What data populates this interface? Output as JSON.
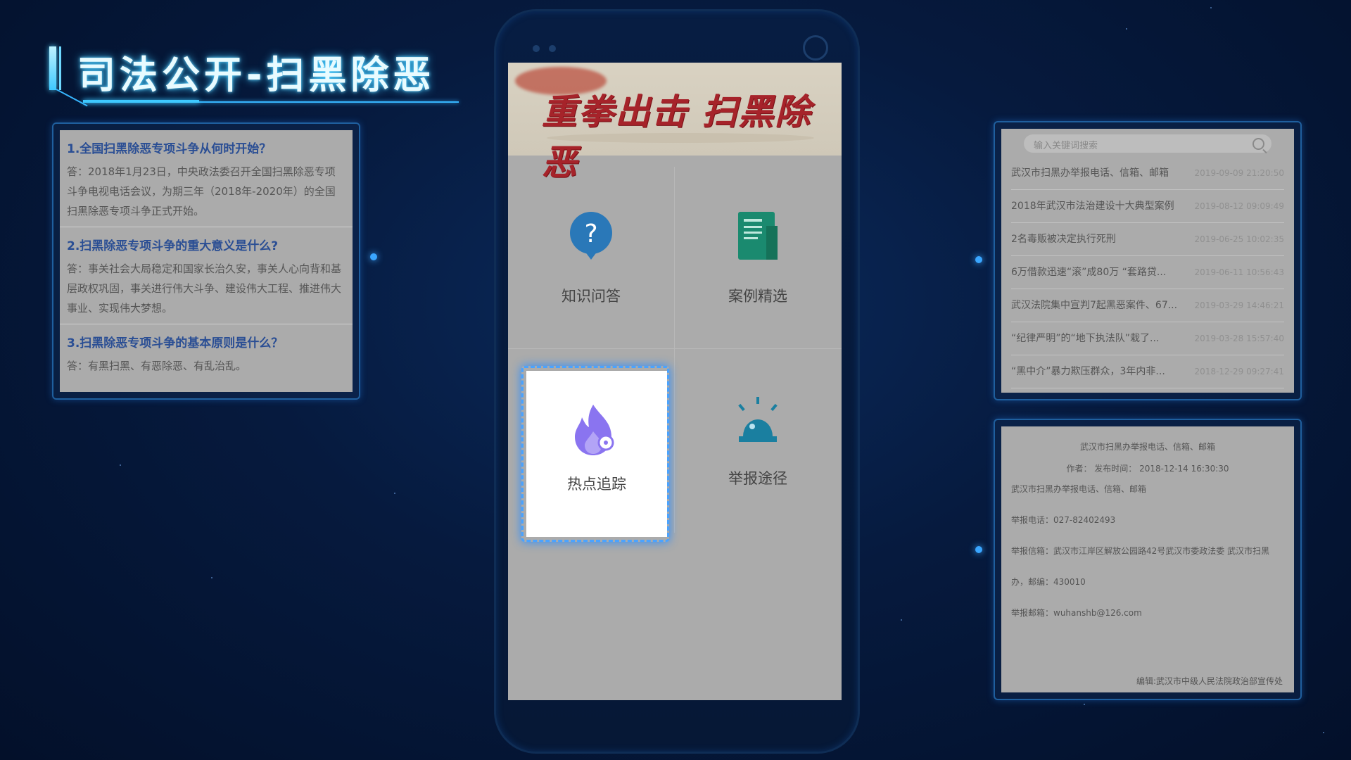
{
  "header": {
    "title": "司法公开-扫黑除恶"
  },
  "faq": {
    "items": [
      {
        "question": "1.全国扫黑除恶专项斗争从何时开始？",
        "answer": "答：2018年1月23日，中央政法委召开全国扫黑除恶专项斗争电视电话会议，为期三年（2018年-2020年）的全国扫黑除恶专项斗争正式开始。"
      },
      {
        "question": "2.扫黑除恶专项斗争的重大意义是什么?",
        "answer": "答：事关社会大局稳定和国家长治久安，事关人心向背和基层政权巩固，事关进行伟大斗争、建设伟大工程、推进伟大事业、实现伟大梦想。"
      },
      {
        "question": "3.扫黑除恶专项斗争的基本原则是什么？",
        "answer": "答：有黑扫黑、有恶除恶、有乱治乱。"
      }
    ]
  },
  "phone": {
    "banner_text": "重拳出击 扫黑除恶",
    "menu": [
      {
        "label": "知识问答",
        "icon": "question-bubble-icon",
        "color": "#2a78b8"
      },
      {
        "label": "案例精选",
        "icon": "document-icon",
        "color": "#1a8a6f"
      },
      {
        "label": "热点追踪",
        "icon": "flame-icon",
        "color": "#8a74f0",
        "selected": true
      },
      {
        "label": "举报途径",
        "icon": "alarm-light-icon",
        "color": "#1a7fa0"
      }
    ]
  },
  "news": {
    "search_placeholder": "输入关键词搜索",
    "rows": [
      {
        "title": "武汉市扫黑办举报电话、信箱、邮箱",
        "date": "2019-09-09 21:20:50"
      },
      {
        "title": "2018年武汉市法治建设十大典型案例",
        "date": "2019-08-12 09:09:49"
      },
      {
        "title": "2名毒贩被决定执行死刑",
        "date": "2019-06-25 10:02:35"
      },
      {
        "title": "6万借款迅速“滚”成80万 “套路贷...",
        "date": "2019-06-11 10:56:43"
      },
      {
        "title": "武汉法院集中宣判7起黑恶案件、67...",
        "date": "2019-03-29 14:46:21"
      },
      {
        "title": "“纪律严明”的“地下执法队”栽了...",
        "date": "2019-03-28 15:57:40"
      },
      {
        "title": "“黑中介”暴力欺压群众，3年内非...",
        "date": "2018-12-29 09:27:41"
      }
    ]
  },
  "article": {
    "title": "武汉市扫黑办举报电话、信箱、邮箱",
    "meta": "作者：  发布时间：  2018-12-14 16:30:30",
    "lines": [
      "武汉市扫黑办举报电话、信箱、邮箱",
      "举报电话：027-82402493",
      "举报信箱：武汉市江岸区解放公园路42号武汉市委政法委 武汉市扫黑",
      "办，邮编：430010",
      "举报邮箱：wuhanshb@126.com"
    ],
    "footer": "编辑:武汉市中级人民法院政治部宣传处"
  }
}
